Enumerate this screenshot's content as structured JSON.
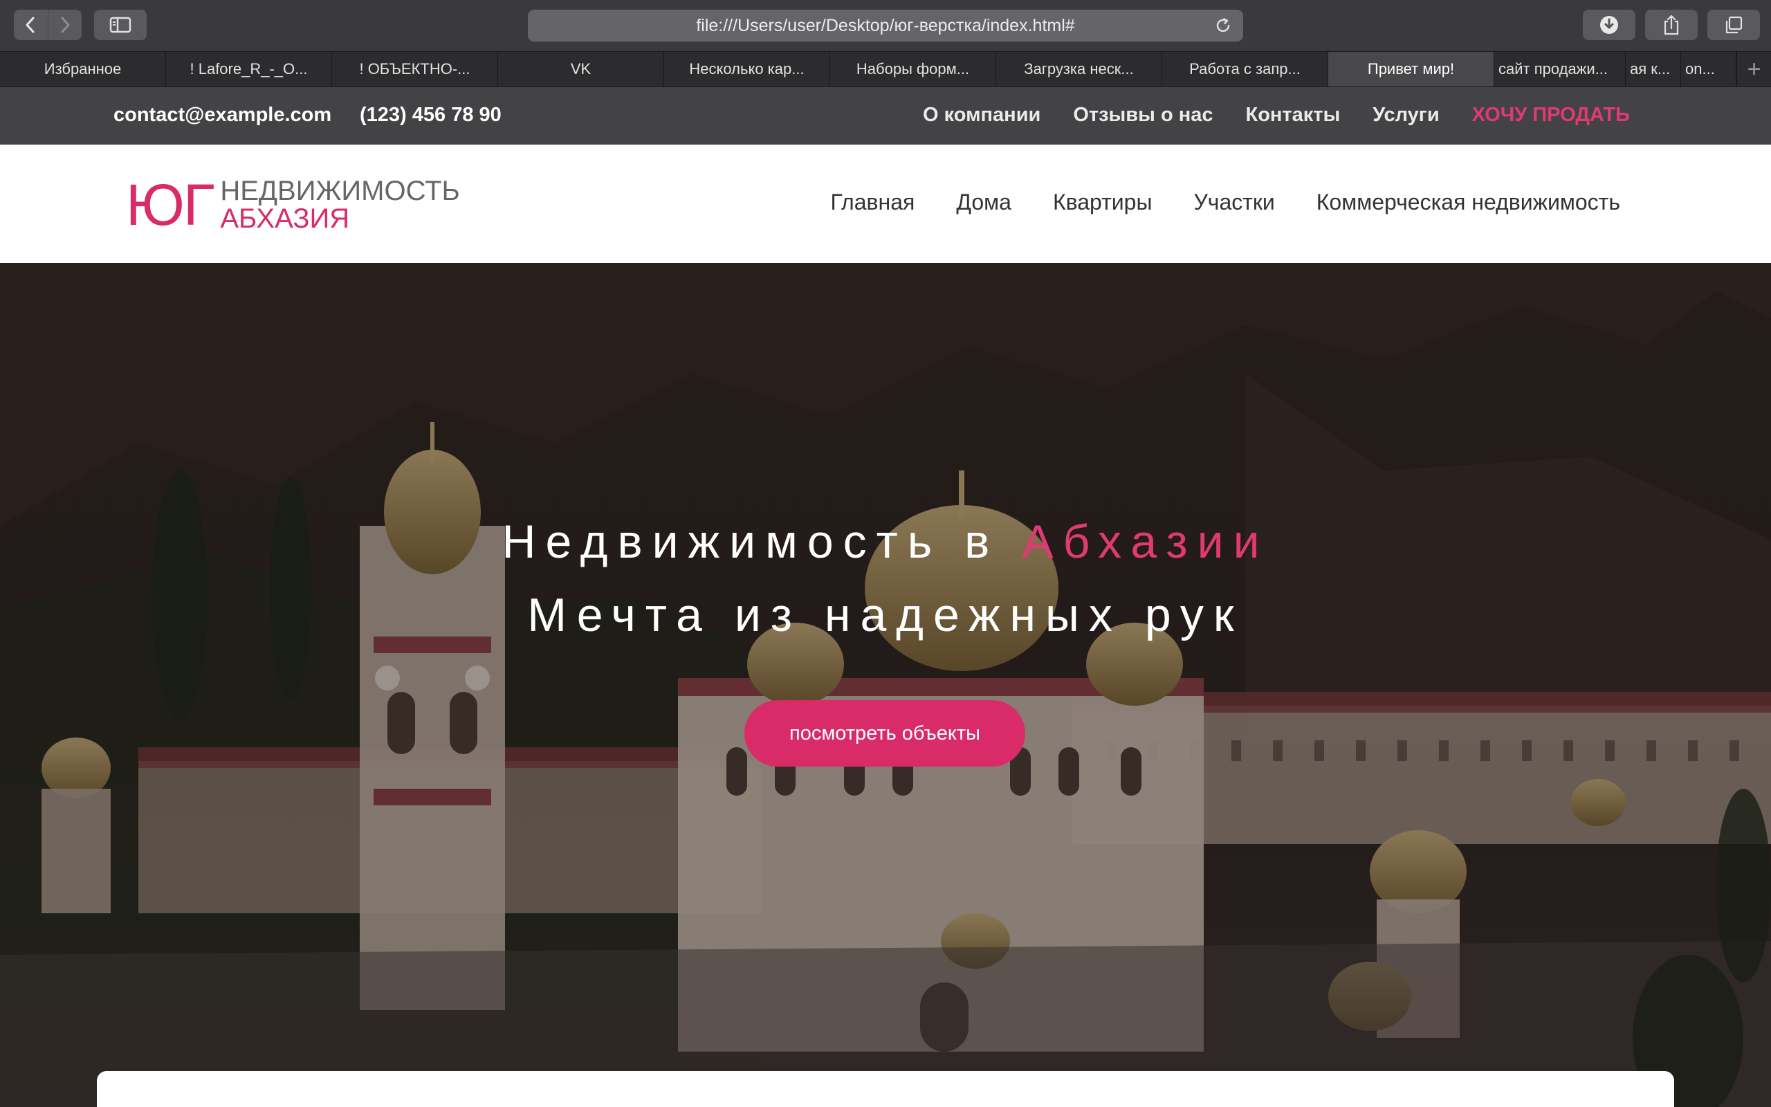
{
  "browser": {
    "url": "file:///Users/user/Desktop/юг-верстка/index.html#",
    "tabs": [
      {
        "label": "Избранное"
      },
      {
        "label": "! Lafore_R_-_O..."
      },
      {
        "label": "! ОБЪЕКТНО-..."
      },
      {
        "label": "VK"
      },
      {
        "label": "Несколько кар..."
      },
      {
        "label": "Наборы форм..."
      },
      {
        "label": "Загрузка неск..."
      },
      {
        "label": "Работа с запр..."
      },
      {
        "label": "Привет мир!"
      },
      {
        "label": "сайт продажи..."
      },
      {
        "label": "ая к..."
      },
      {
        "label": "on..."
      }
    ],
    "new_tab": "+"
  },
  "topbar": {
    "email": "contact@example.com",
    "phone": "(123) 456 78 90",
    "links": [
      {
        "label": "О компании"
      },
      {
        "label": "Отзывы о нас"
      },
      {
        "label": "Контакты"
      },
      {
        "label": "Услуги"
      },
      {
        "label": "ХОЧУ ПРОДАТЬ"
      }
    ]
  },
  "logo": {
    "mark": "ЮГ",
    "line1": "НЕДВИЖИМОСТЬ",
    "line2": "АБХАЗИЯ"
  },
  "nav": [
    {
      "label": "Главная"
    },
    {
      "label": "Дома"
    },
    {
      "label": "Квартиры"
    },
    {
      "label": "Участки"
    },
    {
      "label": "Коммерческая недвижимость"
    }
  ],
  "hero": {
    "line1_a": "Недвижимость в ",
    "line1_b": "Абхазии",
    "line2": "Мечта из надежных рук",
    "button": "посмотреть объекты"
  },
  "colors": {
    "accent": "#d82b67",
    "topbar_bg": "#434345",
    "browser_bg": "#3a3a3c"
  },
  "icons": [
    "back-icon",
    "forward-icon",
    "sidebar-icon",
    "reload-icon",
    "download-icon",
    "share-icon",
    "tabs-overview-icon"
  ]
}
